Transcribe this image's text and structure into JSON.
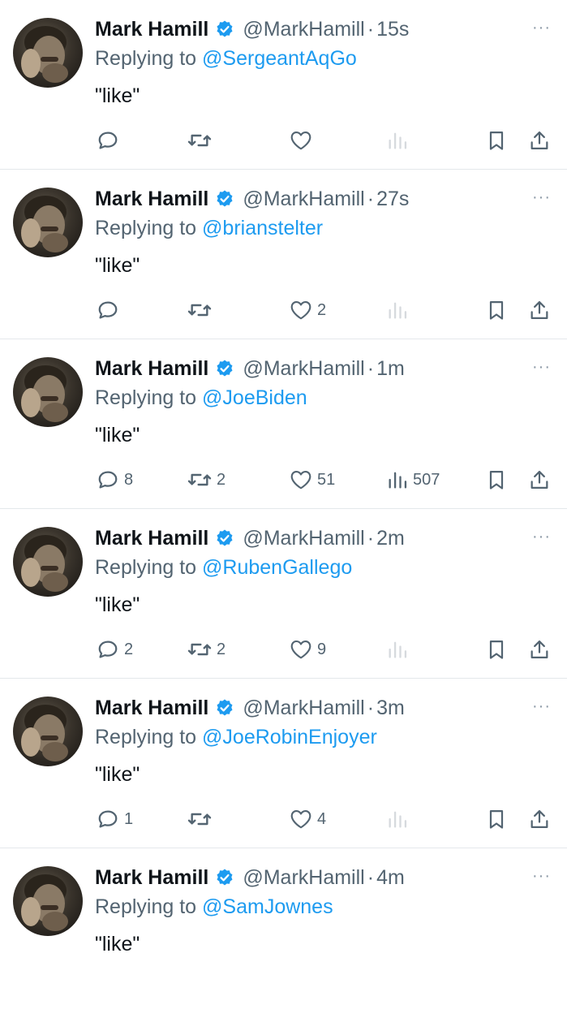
{
  "colors": {
    "accent": "#1d9bf0",
    "text": "#0f1419",
    "secondary": "#536471",
    "verified": "#1d9bf0",
    "divider": "#e4e8eb"
  },
  "icons": {
    "reply": "speech-bubble-icon",
    "retweet": "retweet-arrows-icon",
    "like": "heart-icon",
    "views": "bar-chart-icon",
    "bookmark": "bookmark-icon",
    "share": "upload-arrow-icon",
    "more": "ellipsis-icon",
    "verified": "verified-badge-icon"
  },
  "tweets": [
    {
      "name": "Mark Hamill",
      "handle": "@MarkHamill",
      "separator": "·",
      "time": "15s",
      "replying_prefix": "Replying to",
      "replying_to": "@SergeantAqGo",
      "text": "\"like\"",
      "more": "···",
      "reply_count": "",
      "retweet_count": "",
      "like_count": "",
      "view_count": "",
      "views_dimmed": true
    },
    {
      "name": "Mark Hamill",
      "handle": "@MarkHamill",
      "separator": "·",
      "time": "27s",
      "replying_prefix": "Replying to",
      "replying_to": "@brianstelter",
      "text": "\"like\"",
      "more": "···",
      "reply_count": "",
      "retweet_count": "",
      "like_count": "2",
      "view_count": "",
      "views_dimmed": true
    },
    {
      "name": "Mark Hamill",
      "handle": "@MarkHamill",
      "separator": "·",
      "time": "1m",
      "replying_prefix": "Replying to",
      "replying_to": "@JoeBiden",
      "text": "\"like\"",
      "more": "···",
      "reply_count": "8",
      "retweet_count": "2",
      "like_count": "51",
      "view_count": "507",
      "views_dimmed": false
    },
    {
      "name": "Mark Hamill",
      "handle": "@MarkHamill",
      "separator": "·",
      "time": "2m",
      "replying_prefix": "Replying to",
      "replying_to": "@RubenGallego",
      "text": "\"like\"",
      "more": "···",
      "reply_count": "2",
      "retweet_count": "2",
      "like_count": "9",
      "view_count": "",
      "views_dimmed": true
    },
    {
      "name": "Mark Hamill",
      "handle": "@MarkHamill",
      "separator": "·",
      "time": "3m",
      "replying_prefix": "Replying to",
      "replying_to": "@JoeRobinEnjoyer",
      "text": "\"like\"",
      "more": "···",
      "reply_count": "1",
      "retweet_count": "",
      "like_count": "4",
      "view_count": "",
      "views_dimmed": true
    },
    {
      "name": "Mark Hamill",
      "handle": "@MarkHamill",
      "separator": "·",
      "time": "4m",
      "replying_prefix": "Replying to",
      "replying_to": "@SamJownes",
      "text": "\"like\"",
      "more": "···",
      "reply_count": "",
      "retweet_count": "",
      "like_count": "",
      "view_count": "",
      "views_dimmed": true
    }
  ]
}
